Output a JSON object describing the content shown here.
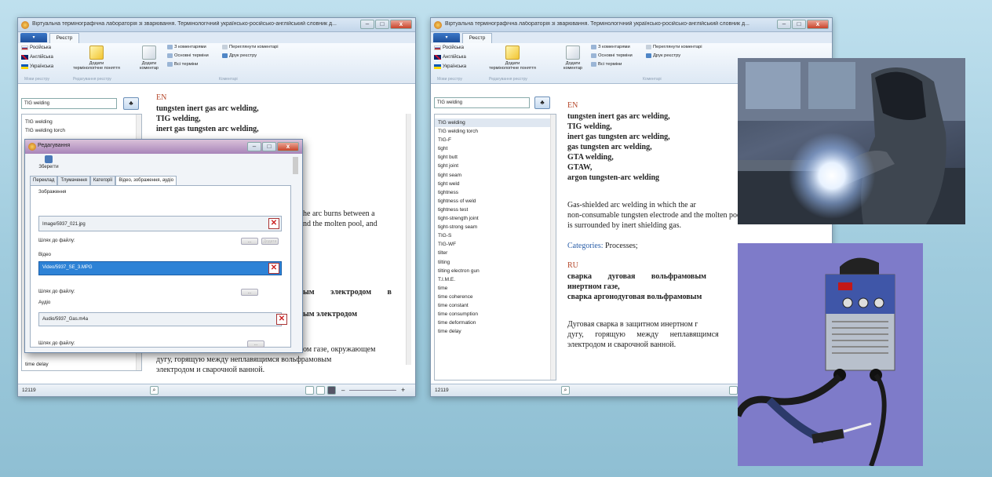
{
  "window_title": "Віртуальна термінографічна лабораторія зі зварювання. Термінологічний українсько-російсько-англійський словник д...",
  "ribbon": {
    "tab_file": "",
    "tab_register": "Реєстр",
    "lang_ru": "Російська",
    "lang_en": "Англійська",
    "lang_uk": "Українська",
    "group_lang": "Мови реєстру",
    "add_term_line1": "Додати",
    "add_term_line2": "термінологічне поняття",
    "group_edit": "Редагування реєстру",
    "add_comment_line1": "Додати",
    "add_comment_line2": "коментар",
    "with_comments": "З коментарями",
    "main_terms": "Основні терміни",
    "all_terms": "Всі терміни",
    "view_comments": "Переглянути коментарі",
    "print_register": "Друк реєстру",
    "group_comments": "Коментарі"
  },
  "search_value": "TIG welding",
  "status_count": "12119",
  "left_list": [
    "TIG welding",
    "TIG welding torch"
  ],
  "left_list_bottom": "time delay",
  "right_list": [
    "TIG welding",
    "TIG welding torch",
    "TIG-F",
    "tight",
    "tight butt",
    "tight joint",
    "tight seam",
    "tight weld",
    "tightness",
    "tightness of weld",
    "tightness test",
    "tight-strength joint",
    "tight-strong seam",
    "TIG-S",
    "TIG-WF",
    "tilter",
    "tilting",
    "tilting electron gun",
    "T.I.M.E.",
    "time",
    "time coherence",
    "time constant",
    "time consumption",
    "time deformation",
    "time delay"
  ],
  "entry": {
    "en_header": "EN",
    "en_terms": [
      "tungsten inert gas arc welding,",
      "TIG welding,",
      "inert gas tungsten arc welding,",
      "gas tungsten arc welding,",
      "GTA welding,",
      "GTAW,",
      "argon tungsten-arc welding"
    ],
    "definition": "Gas-shielded arc welding in which the arc burns between a non-consumable tungsten electrode and the molten pool, and is surrounded by inert shielding gas.",
    "categories_label": "Categories:",
    "categories_value": "Processes;",
    "ru_header": "RU",
    "ru_terms": [
      "сварка дуговая вольфрамовым электродом в инертном газе,",
      "сварка аргонодуговая вольфрамовым электродом"
    ],
    "ru_definition": "Дуговая сварка в защитном инертном газе, окружающем дугу, горящую между неплавящимся вольфрамовым электродом и сварочной ванной."
  },
  "left_visible": {
    "def_line1": "he arc burns between a",
    "def_line2": "nd the molten pool, and",
    "ru_frag1": "ым электродом в",
    "ru_frag2": "ым электродом",
    "ru_def_line1": "ом газе, окружающем",
    "ru_def_line2": "дугу, горящую между неплавящимся вольфрамовым",
    "ru_def_line3": "электродом и сварочной ванной."
  },
  "right_visible": {
    "def_line1": "Gas-shielded arc welding in which the ar",
    "def_line2": "non-consumable tungsten electrode and the molten pool, and",
    "def_line3": "is surrounded by inert shielding gas.",
    "ru_line1": "сварка дуговая вольфрамовым",
    "ru_line2": "инертном газе,",
    "ru_line3": "сварка аргонодуговая вольфрамовым",
    "ru_def_line1": "Дуговая сварка в защитном инертном г",
    "ru_def_line2": "дугу, горящую между неплавящимся",
    "ru_def_line3": "электродом и сварочной ванной."
  },
  "dialog": {
    "title": "Редагування",
    "save": "Зберегти",
    "tabs": [
      "Переклад",
      "Тлумачення",
      "Категорії",
      "Відео, зображення, аудіо"
    ],
    "image_label": "Зображення",
    "image_path": "Image/5937_021.jpg",
    "video_label": "Відео",
    "video_path": "Video/5937_SE_3.MPG",
    "audio_label": "Аудіо",
    "audio_path": "Audio/5937_Gas.m4a",
    "file_path_label": "Шлях до файлу:",
    "browse": "...",
    "clear": "Додати"
  },
  "colors": {
    "accent": "#2d82d6",
    "term_header": "#b5472a",
    "category_link": "#2a5ea8"
  }
}
